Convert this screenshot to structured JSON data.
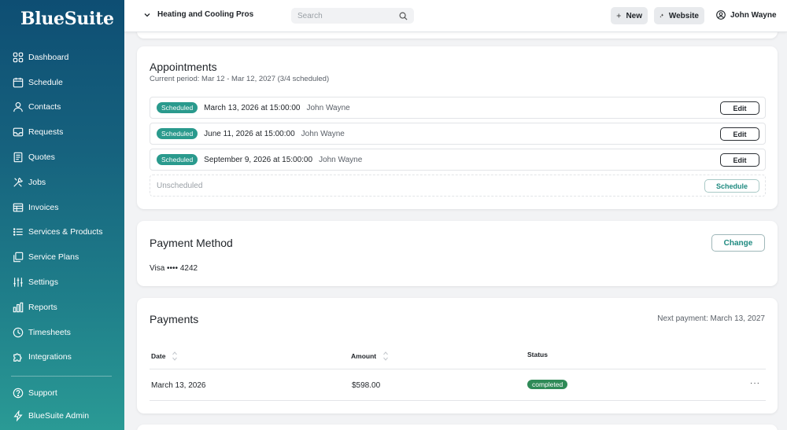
{
  "app": {
    "logo": "BlueSuite"
  },
  "sidebar": {
    "items": [
      {
        "label": "Dashboard",
        "icon": "grid-icon"
      },
      {
        "label": "Schedule",
        "icon": "calendar-icon"
      },
      {
        "label": "Contacts",
        "icon": "person-icon"
      },
      {
        "label": "Requests",
        "icon": "inbox-icon"
      },
      {
        "label": "Quotes",
        "icon": "document-icon"
      },
      {
        "label": "Jobs",
        "icon": "tools-icon"
      },
      {
        "label": "Invoices",
        "icon": "table-icon"
      },
      {
        "label": "Services & Products",
        "icon": "list-icon"
      },
      {
        "label": "Service Plans",
        "icon": "copy-icon"
      },
      {
        "label": "Settings",
        "icon": "sliders-icon"
      },
      {
        "label": "Reports",
        "icon": "bar-chart-icon"
      },
      {
        "label": "Timesheets",
        "icon": "clock-icon"
      },
      {
        "label": "Integrations",
        "icon": "puzzle-icon"
      }
    ],
    "bottom": [
      {
        "label": "Support",
        "icon": "help-icon"
      },
      {
        "label": "BlueSuite Admin",
        "icon": "bolt-icon"
      }
    ]
  },
  "topbar": {
    "company": "Heating and Cooling Pros",
    "search_placeholder": "Search",
    "new_label": "New",
    "website_label": "Website",
    "user_name": "John Wayne"
  },
  "appointments": {
    "title": "Appointments",
    "period": "Current period: Mar 12 - Mar 12, 2027 (3/4 scheduled)",
    "rows": [
      {
        "status": "Scheduled",
        "date": "March 13, 2026 at 15:00:00",
        "assignee": "John Wayne",
        "action": "Edit"
      },
      {
        "status": "Scheduled",
        "date": "June 11, 2026 at 15:00:00",
        "assignee": "John Wayne",
        "action": "Edit"
      },
      {
        "status": "Scheduled",
        "date": "September 9, 2026 at 15:00:00",
        "assignee": "John Wayne",
        "action": "Edit"
      }
    ],
    "unscheduled": {
      "label": "Unscheduled",
      "action": "Schedule"
    }
  },
  "payment_method": {
    "title": "Payment Method",
    "card": "Visa •••• 4242",
    "change_label": "Change"
  },
  "payments": {
    "title": "Payments",
    "next_payment": "Next payment: March 13, 2027",
    "columns": {
      "date": "Date",
      "amount": "Amount",
      "status": "Status"
    },
    "rows": [
      {
        "date": "March 13, 2026",
        "amount": "$598.00",
        "status": "completed",
        "more": "···"
      }
    ]
  },
  "colors": {
    "accent": "#2a9a8d",
    "sidebar_top": "#0e4e73",
    "sidebar_bottom": "#2a9a95",
    "completed": "#2f8a57"
  }
}
